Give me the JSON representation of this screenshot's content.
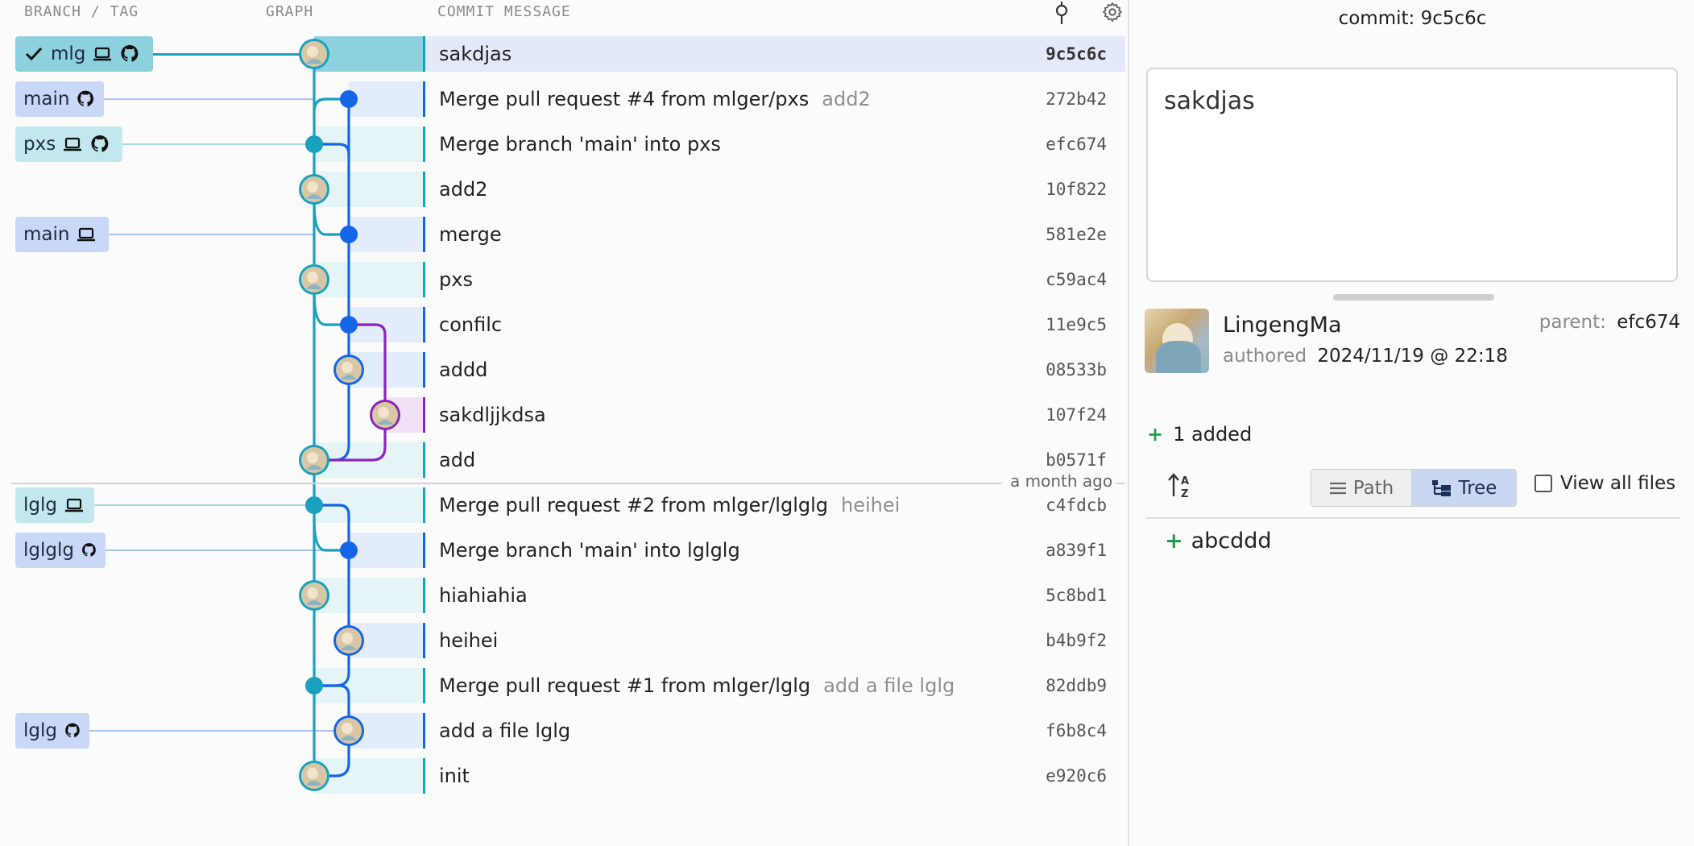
{
  "headers": {
    "branch_tag": "BRANCH / TAG",
    "graph": "GRAPH",
    "commit_message": "COMMIT MESSAGE"
  },
  "rows": [
    {
      "message": "sakdjas",
      "sub": "",
      "hash": "9c5c6c"
    },
    {
      "message": "Merge pull request #4 from mlger/pxs",
      "sub": "add2",
      "hash": "272b42"
    },
    {
      "message": "Merge branch 'main' into pxs",
      "sub": "",
      "hash": "efc674"
    },
    {
      "message": "add2",
      "sub": "",
      "hash": "10f822"
    },
    {
      "message": "merge",
      "sub": "",
      "hash": "581e2e"
    },
    {
      "message": "pxs",
      "sub": "",
      "hash": "c59ac4"
    },
    {
      "message": "confilc",
      "sub": "",
      "hash": "11e9c5"
    },
    {
      "message": "addd",
      "sub": "",
      "hash": "08533b"
    },
    {
      "message": "sakdljjkdsa",
      "sub": "",
      "hash": "107f24"
    },
    {
      "message": "add",
      "sub": "",
      "hash": "b0571f"
    },
    {
      "message": "Merge pull request #2 from mlger/lglglg",
      "sub": "heihei",
      "hash": "c4fdcb"
    },
    {
      "message": "Merge branch 'main' into lglglg",
      "sub": "",
      "hash": "a839f1"
    },
    {
      "message": "hiahiahia",
      "sub": "",
      "hash": "5c8bd1"
    },
    {
      "message": "heihei",
      "sub": "",
      "hash": "b4b9f2"
    },
    {
      "message": "Merge pull request #1 from mlger/lglg",
      "sub": "add a file lglg",
      "hash": "82ddb9"
    },
    {
      "message": "add a file lglg",
      "sub": "",
      "hash": "f6b8c4"
    },
    {
      "message": "init",
      "sub": "",
      "hash": "e920c6"
    }
  ],
  "refs": [
    {
      "label": "mlg",
      "icons": [
        "check-icon",
        "laptop-icon",
        "github-icon"
      ]
    },
    {
      "label": "main",
      "icons": [
        "github-icon"
      ]
    },
    {
      "label": "pxs",
      "icons": [
        "laptop-icon",
        "github-icon"
      ]
    },
    {
      "label": "main",
      "icons": [
        "laptop-icon"
      ]
    },
    {
      "label": "lglg",
      "icons": [
        "laptop-icon"
      ]
    },
    {
      "label": "lglglg",
      "icons": [
        "github-icon"
      ]
    },
    {
      "label": "lglg",
      "icons": [
        "github-icon"
      ]
    }
  ],
  "time_separator": "a month ago",
  "detail": {
    "commit_label": "commit:",
    "commit_hash": "9c5c6c",
    "message_text": "sakdjas",
    "author": "LingengMa",
    "authored_label": "authored",
    "authored_date": "2024/11/19 @ 22:18",
    "parent_label": "parent:",
    "parent_hash": "efc674",
    "added_count": "1 added",
    "path_label": "Path",
    "tree_label": "Tree",
    "view_all_label": "View all files",
    "files": [
      "abcddd"
    ]
  },
  "colors": {
    "teal": "#1aa0bf",
    "blue": "#1565e8",
    "purple": "#8b26b7",
    "added_green": "#1e9e4e"
  }
}
